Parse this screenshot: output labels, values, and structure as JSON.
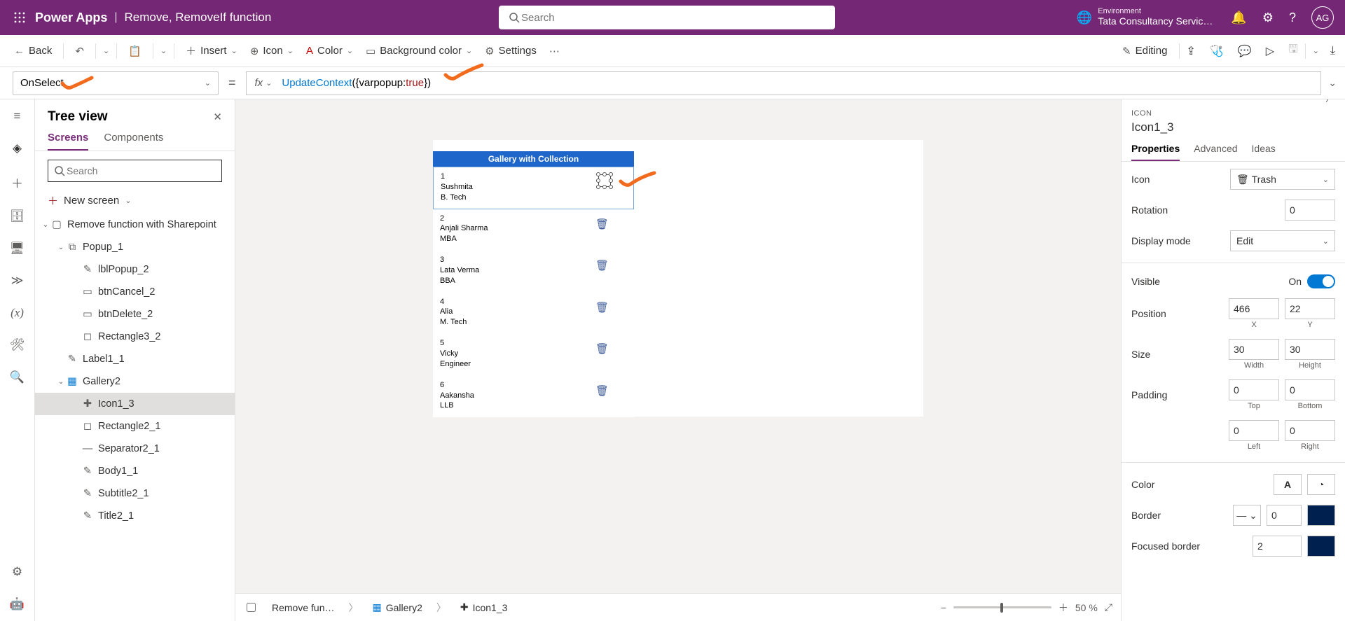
{
  "header": {
    "app": "Power Apps",
    "file": "Remove, RemoveIf function",
    "search_placeholder": "Search",
    "env_label": "Environment",
    "env_name": "Tata Consultancy Servic…",
    "avatar": "AG"
  },
  "cmd": {
    "back": "Back",
    "insert": "Insert",
    "icon": "Icon",
    "color": "Color",
    "bgcolor": "Background color",
    "settings": "Settings",
    "editing": "Editing"
  },
  "fx": {
    "property": "OnSelect",
    "fx_label": "fx",
    "formula_fn": "UpdateContext",
    "formula_open": "({varpopup: ",
    "formula_bool": "true",
    "formula_close": "})"
  },
  "tree": {
    "title": "Tree view",
    "tab_screens": "Screens",
    "tab_components": "Components",
    "search_placeholder": "Search",
    "new_screen": "New screen",
    "screen": "Remove function with Sharepoint",
    "nodes": {
      "popup": "Popup_1",
      "lbl": "lblPopup_2",
      "cancel": "btnCancel_2",
      "delete": "btnDelete_2",
      "rect3": "Rectangle3_2",
      "label1": "Label1_1",
      "gallery": "Gallery2",
      "icon": "Icon1_3",
      "rect2": "Rectangle2_1",
      "sep": "Separator2_1",
      "body": "Body1_1",
      "subtitle": "Subtitle2_1",
      "title": "Title2_1"
    }
  },
  "canvas": {
    "gallery_title": "Gallery with Collection",
    "items": [
      {
        "n": "1",
        "name": "Sushmita",
        "deg": "B. Tech"
      },
      {
        "n": "2",
        "name": "Anjali Sharma",
        "deg": "MBA"
      },
      {
        "n": "3",
        "name": "Lata Verma",
        "deg": "BBA"
      },
      {
        "n": "4",
        "name": "Alia",
        "deg": "M. Tech"
      },
      {
        "n": "5",
        "name": "Vicky",
        "deg": "Engineer"
      },
      {
        "n": "6",
        "name": "Aakansha",
        "deg": "LLB"
      }
    ]
  },
  "breadcrumb": {
    "screen": "Remove fun…",
    "gallery": "Gallery2",
    "icon": "Icon1_3",
    "zoom": "50 %"
  },
  "props": {
    "kind": "ICON",
    "name": "Icon1_3",
    "tab_props": "Properties",
    "tab_adv": "Advanced",
    "tab_ideas": "Ideas",
    "icon_label": "Icon",
    "icon_value": "Trash",
    "rotation_label": "Rotation",
    "rotation_value": "0",
    "display_label": "Display mode",
    "display_value": "Edit",
    "visible_label": "Visible",
    "visible_value": "On",
    "position_label": "Position",
    "pos_x": "466",
    "pos_y": "22",
    "xlbl": "X",
    "ylbl": "Y",
    "size_label": "Size",
    "width": "30",
    "height": "30",
    "wlbl": "Width",
    "hlbl": "Height",
    "padding_label": "Padding",
    "pad_t": "0",
    "pad_b": "0",
    "pad_l": "0",
    "pad_r": "0",
    "tlbl": "Top",
    "blbl": "Bottom",
    "llbl": "Left",
    "rlbl": "Right",
    "color_label": "Color",
    "border_label": "Border",
    "border_val": "0",
    "fborder_label": "Focused border",
    "fborder_val": "2"
  }
}
